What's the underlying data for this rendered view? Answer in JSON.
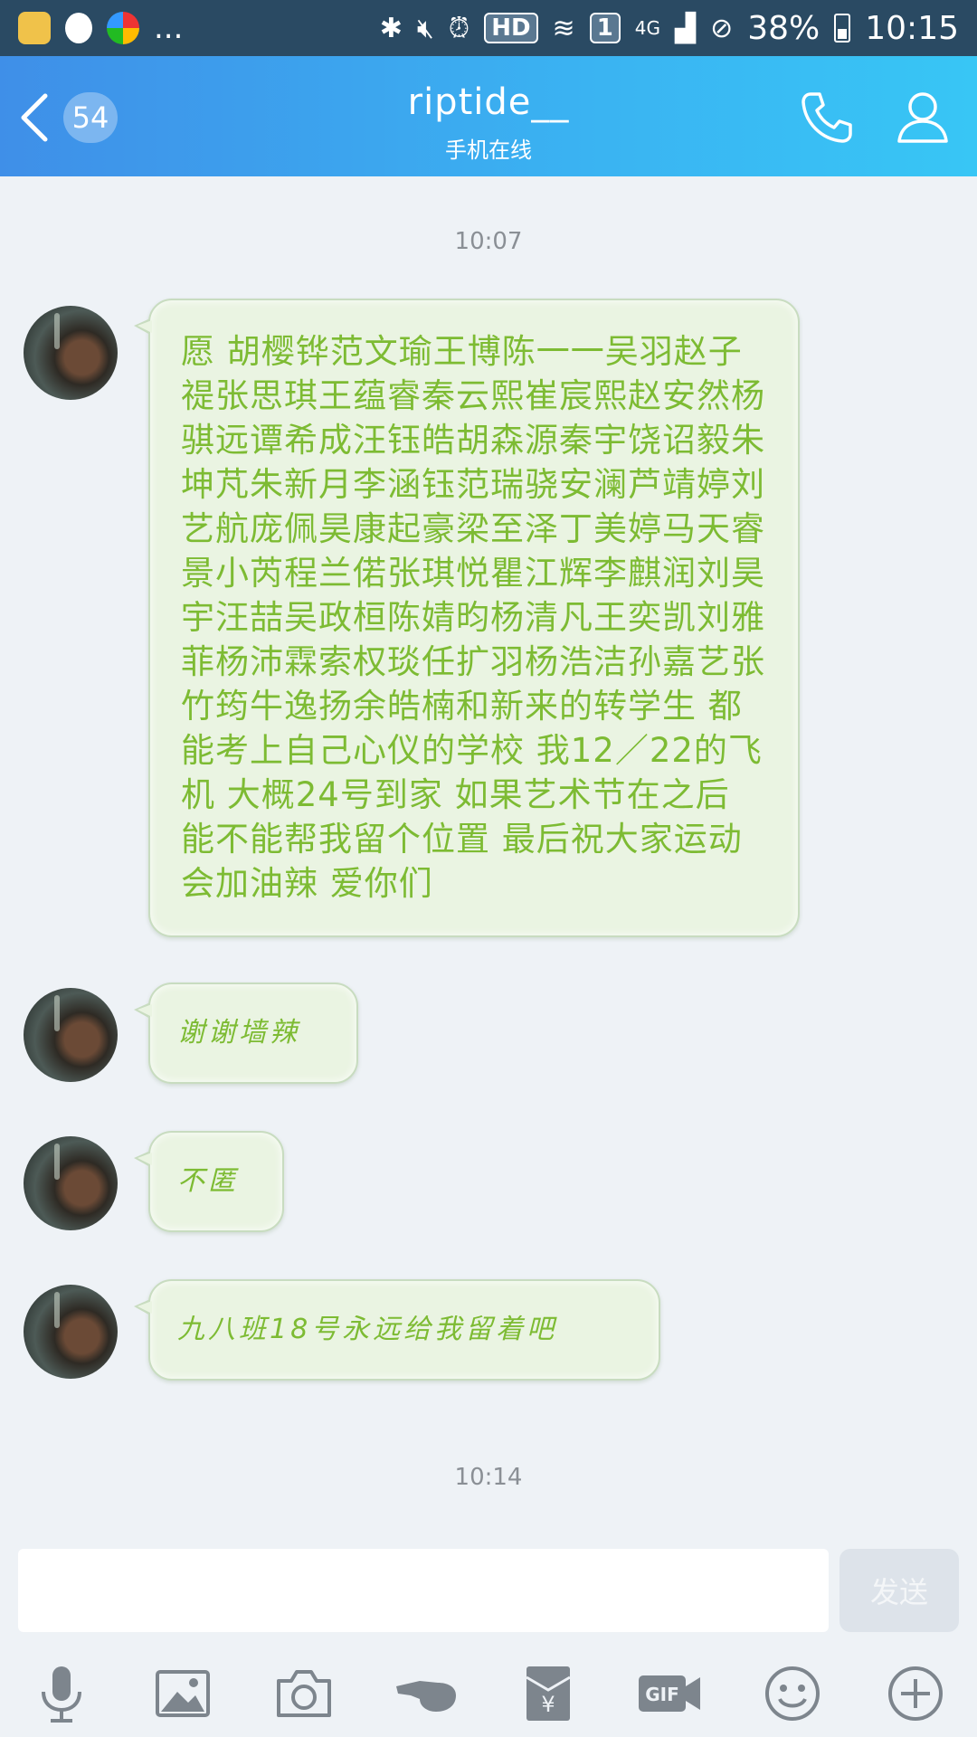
{
  "status_bar": {
    "battery": "38%",
    "time": "10:15",
    "network": "4G",
    "hd": "HD",
    "sim": "1",
    "more": "..."
  },
  "header": {
    "back_badge": "54",
    "title": "riptide__",
    "subtitle": "手机在线"
  },
  "chat": {
    "timestamps": [
      "10:07",
      "10:14"
    ],
    "messages": [
      {
        "text": "愿 胡樱铧范文瑜王博陈一一吴羽赵子禔张思琪王蕴睿秦云熙崔宸熙赵安然杨骐远谭希成汪钰皓胡森源秦宇饶诏毅朱坤芃朱新月李涵钰范瑞骁安澜芦靖婷刘艺航庞佩昊康起豪梁至泽丁美婷马天睿景小芮程兰偌张琪悦瞿江辉李麒润刘昊宇汪喆吴政桓陈婧昀杨清凡王奕凯刘雅菲杨沛霖索权琰任扩羽杨浩洁孙嘉艺张竹筠牛逸扬余皓楠和新来的转学生 都能考上自己心仪的学校 我12／22的飞机 大概24号到家 如果艺术节在之后 能不能帮我留个位置 最后祝大家运动会加油辣 爱你们"
      },
      {
        "text": "谢谢墙辣"
      },
      {
        "text": "不匿"
      },
      {
        "text": "九八班18号永远给我留着吧"
      }
    ]
  },
  "input": {
    "placeholder": "",
    "value": "",
    "send_label": "发送"
  },
  "toolbar": {
    "items": [
      "microphone-icon",
      "image-icon",
      "camera-icon",
      "poke-icon",
      "red-packet-icon",
      "gif-icon",
      "emoji-icon",
      "plus-icon"
    ],
    "gif_label": "GIF",
    "yen_label": "¥"
  },
  "colors": {
    "header_start": "#3f8fe8",
    "header_end": "#38c6f5",
    "bubble_text": "#7dbb33",
    "bubble_bg": "#eaf4e2",
    "background": "#eef2f6"
  }
}
